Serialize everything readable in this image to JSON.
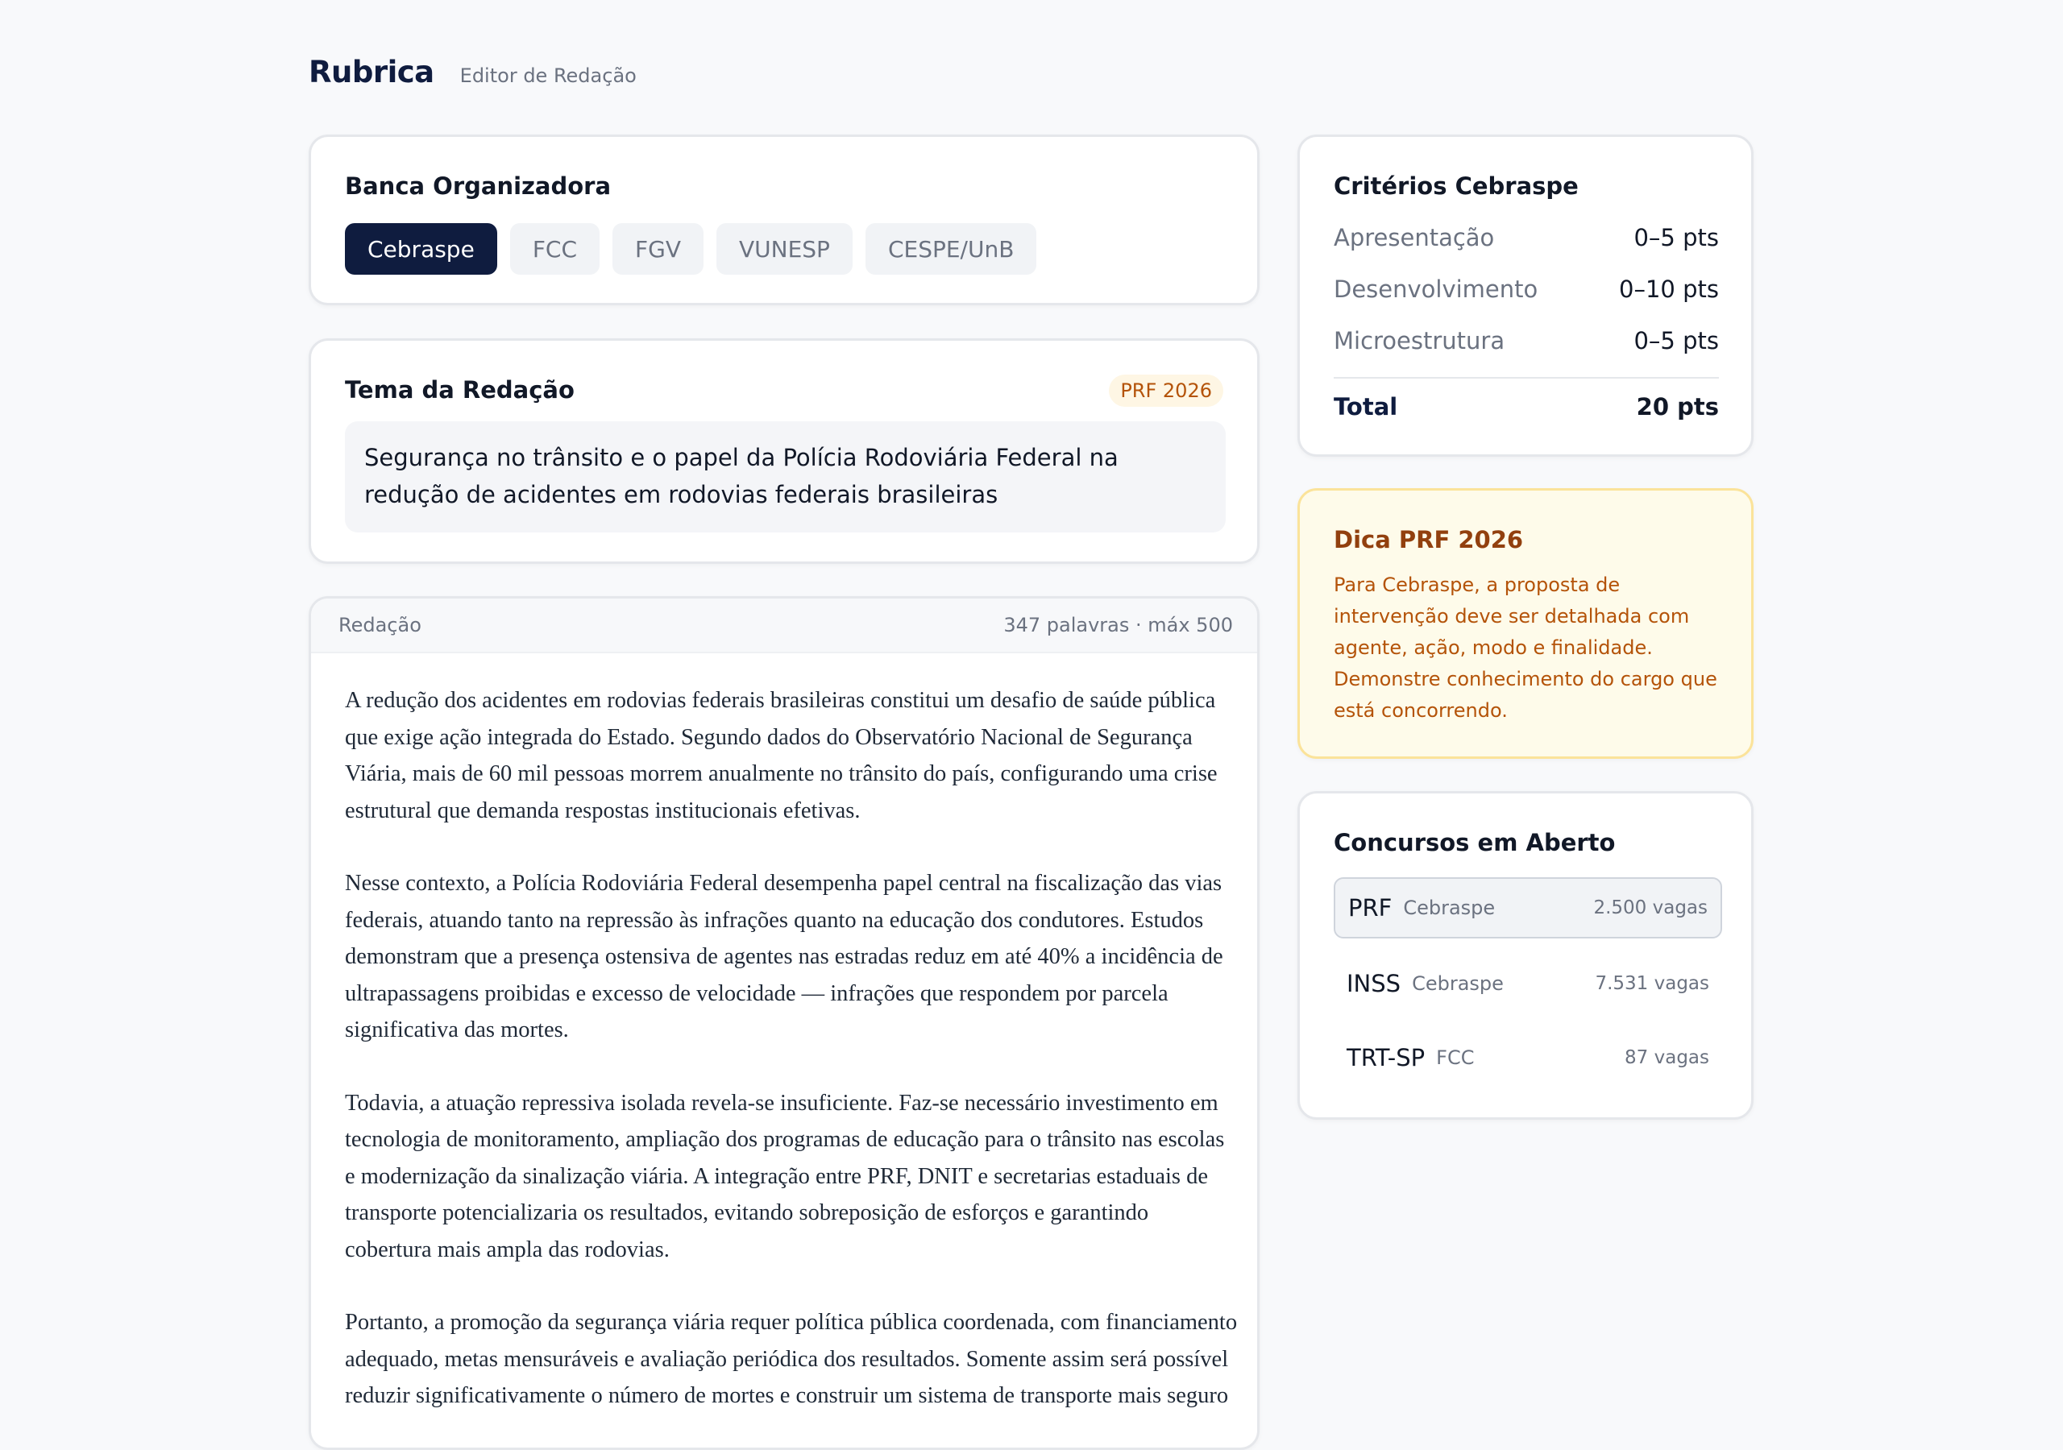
{
  "header": {
    "brand": "Rubrica",
    "subtitle": "Editor de Redação"
  },
  "banca": {
    "title": "Banca Organizadora",
    "options": [
      "Cebraspe",
      "FCC",
      "FGV",
      "VUNESP",
      "CESPE/UnB"
    ],
    "selected": "Cebraspe"
  },
  "tema": {
    "title": "Tema da Redação",
    "badge": "PRF 2026",
    "text": "Segurança no trânsito e o papel da Polícia Rodoviária Federal na redução de acidentes em rodovias federais brasileiras"
  },
  "redacao": {
    "label": "Redação",
    "count": "347 palavras · máx 500",
    "paragraphs": [
      "A redução dos acidentes em rodovias federais brasileiras constitui um desafio de saúde pública que exige ação integrada do Estado. Segundo dados do Observatório Nacional de Segurança Viária, mais de 60 mil pessoas morrem anualmente no trânsito do país, configurando uma crise estrutural que demanda respostas institucionais efetivas.",
      "Nesse contexto, a Polícia Rodoviária Federal desempenha papel central na fiscalização das vias federais, atuando tanto na repressão às infrações quanto na educação dos condutores. Estudos demonstram que a presença ostensiva de agentes nas estradas reduz em até 40% a incidência de ultrapassagens proibidas e excesso de velocidade — infrações que respondem por parcela significativa das mortes.",
      "Todavia, a atuação repressiva isolada revela-se insuficiente. Faz-se necessário investimento em tecnologia de monitoramento, ampliação dos programas de educação para o trânsito nas escolas e modernização da sinalização viária. A integração entre PRF, DNIT e secretarias estaduais de transporte potencializaria os resultados, evitando sobreposição de esforços e garantindo cobertura mais ampla das rodovias.",
      "Portanto, a promoção da segurança viária requer política pública coordenada, com financiamento adequado, metas mensuráveis e avaliação periódica dos resultados. Somente assim será possível reduzir significativamente o número de mortes e construir um sistema de transporte mais seguro"
    ]
  },
  "criterios": {
    "title": "Critérios Cebraspe",
    "items": [
      {
        "name": "Apresentação",
        "value": "0–5 pts"
      },
      {
        "name": "Desenvolvimento",
        "value": "0–10 pts"
      },
      {
        "name": "Microestrutura",
        "value": "0–5 pts"
      }
    ],
    "total_label": "Total",
    "total_value": "20 pts"
  },
  "dica": {
    "title": "Dica PRF 2026",
    "text": "Para Cebraspe, a proposta de intervenção deve ser detalhada com agente, ação, modo e finalidade. Demonstre conhecimento do cargo que está concorrendo."
  },
  "concursos": {
    "title": "Concursos em Aberto",
    "items": [
      {
        "name": "PRF",
        "banca": "Cebraspe",
        "vagas": "2.500 vagas"
      },
      {
        "name": "INSS",
        "banca": "Cebraspe",
        "vagas": "7.531 vagas"
      },
      {
        "name": "TRT-SP",
        "banca": "FCC",
        "vagas": "87 vagas"
      }
    ],
    "selected": "PRF"
  },
  "colors": {
    "brand_navy": "#0f1c3f",
    "accent_amber": "#b45309",
    "tip_background": "#fefbea"
  }
}
